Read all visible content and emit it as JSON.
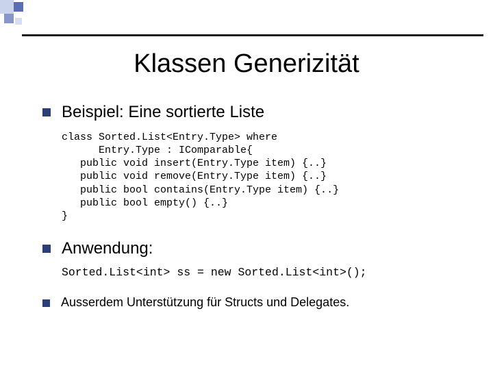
{
  "title": "Klassen Generizität",
  "bullets": {
    "b1": "Beispiel: Eine sortierte Liste",
    "b2": "Anwendung:",
    "b3": "Ausserdem Unterstützung für Structs und Delegates."
  },
  "code1": "class Sorted.List<Entry.Type> where\n      Entry.Type : IComparable{\n   public void insert(Entry.Type item) {..}\n   public void remove(Entry.Type item) {..}\n   public bool contains(Entry.Type item) {..}\n   public bool empty() {..}\n}",
  "code2": "Sorted.List<int> ss = new Sorted.List<int>();"
}
